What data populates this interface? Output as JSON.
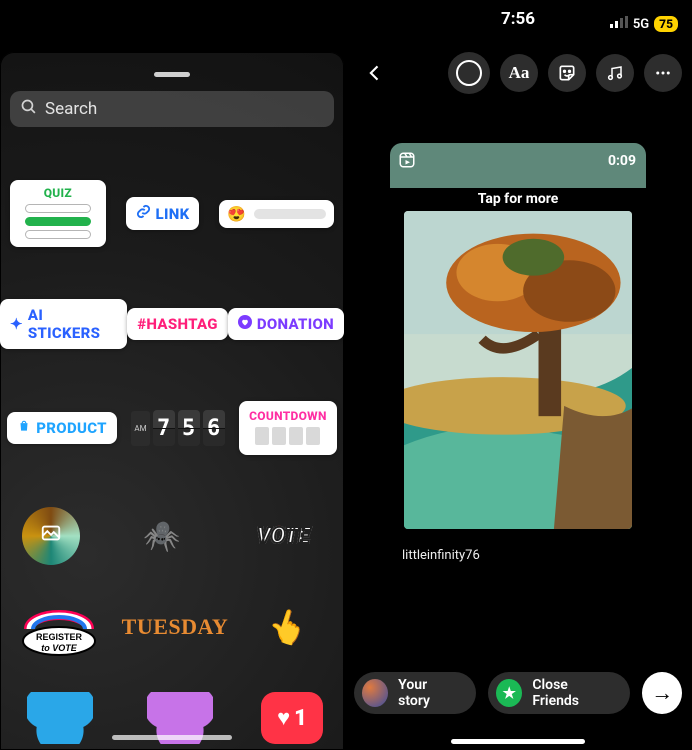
{
  "statusbar": {
    "time": "7:56",
    "network": "5G",
    "battery": "75"
  },
  "toolbar": {
    "text_label": "Aa"
  },
  "search": {
    "placeholder": "Search"
  },
  "stickers": {
    "quiz": "QUIZ",
    "link": "LINK",
    "ai": "AI STICKERS",
    "hashtag": "#HASHTAG",
    "donation": "DONATION",
    "product": "PRODUCT",
    "clock_period": "AM",
    "clock_digits": [
      "7",
      "5",
      "6"
    ],
    "countdown": "COUNTDOWN",
    "vote": "VOTE",
    "day": "TUESDAY",
    "heart_count": "1"
  },
  "canvas": {
    "timecode": "0:09",
    "tap_more": "Tap for more",
    "username": "littleinfinity76"
  },
  "share": {
    "your_story": "Your story",
    "close_friends": "Close Friends"
  }
}
